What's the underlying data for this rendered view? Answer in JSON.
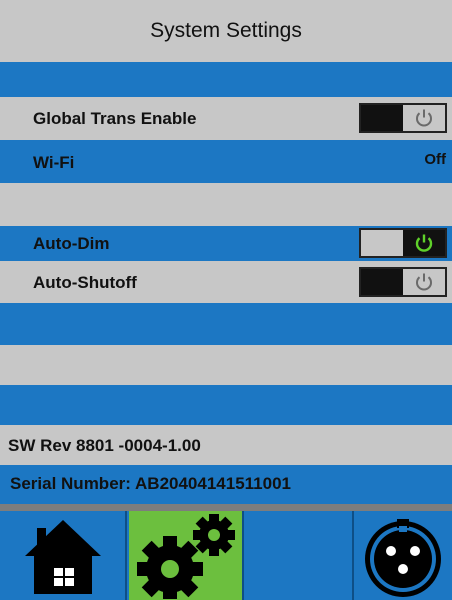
{
  "header": {
    "title": "System Settings"
  },
  "settings": {
    "global_trans": {
      "label": "Global Trans Enable",
      "state": "off"
    },
    "wifi": {
      "label": "Wi-Fi",
      "value": "Off"
    },
    "auto_dim": {
      "label": "Auto-Dim",
      "state": "on"
    },
    "auto_shutoff": {
      "label": "Auto-Shutoff",
      "state": "off"
    }
  },
  "info": {
    "sw_rev": "SW  Rev 8801 -0004-1.00",
    "serial": "Serial Number:  AB20404141511001"
  },
  "tabs": [
    {
      "name": "home",
      "icon": "home-icon"
    },
    {
      "name": "settings",
      "icon": "gear-icon",
      "active": true
    },
    {
      "name": "blank",
      "icon": ""
    },
    {
      "name": "connector",
      "icon": "xlr-connector-icon"
    }
  ],
  "colors": {
    "blue": "#1c77c3",
    "gray": "#c7c7c7",
    "active_tab": "#6cbf3e",
    "power_on": "#5fd12a"
  }
}
